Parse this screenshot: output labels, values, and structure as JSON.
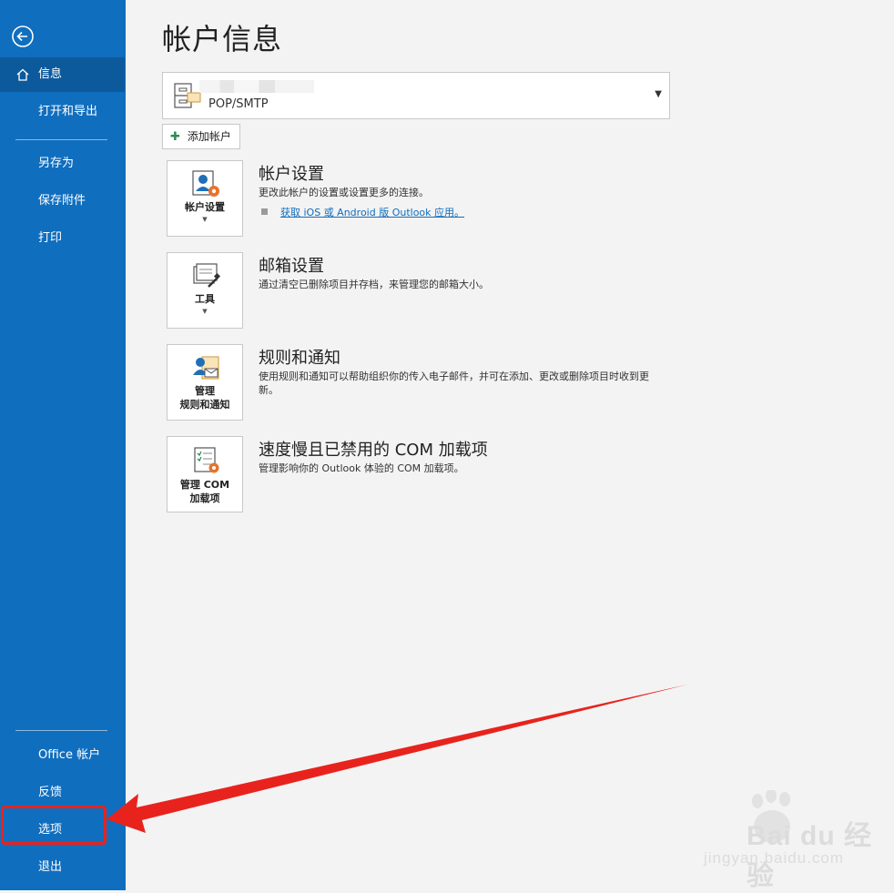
{
  "sidebar": {
    "items": [
      {
        "label": "信息"
      },
      {
        "label": "打开和导出"
      },
      {
        "label": "另存为"
      },
      {
        "label": "保存附件"
      },
      {
        "label": "打印"
      },
      {
        "label": "Office 帐户"
      },
      {
        "label": "反馈"
      },
      {
        "label": "选项"
      },
      {
        "label": "退出"
      }
    ]
  },
  "main": {
    "title": "帐户信息",
    "account": {
      "type": "POP/SMTP"
    },
    "add_account_label": "添加帐户",
    "sections": [
      {
        "button_label": "帐户设置",
        "title": "帐户设置",
        "description": "更改此帐户的设置或设置更多的连接。",
        "link": "获取 iOS 或 Android 版 Outlook 应用。"
      },
      {
        "button_label": "工具",
        "title": "邮箱设置",
        "description": "通过清空已删除项目并存档，来管理您的邮箱大小。"
      },
      {
        "button_label_line1": "管理",
        "button_label_line2": "规则和通知",
        "title": "规则和通知",
        "description": "使用规则和通知可以帮助组织你的传入电子邮件，并可在添加、更改或删除项目时收到更新。"
      },
      {
        "button_label_line1": "管理 COM",
        "button_label_line2": "加载项",
        "title": "速度慢且已禁用的 COM 加载项",
        "description": "管理影响你的 Outlook 体验的 COM 加载项。"
      }
    ]
  },
  "watermark": {
    "text": "Bai du 经验",
    "sub": "jingyan.baidu.com"
  },
  "colors": {
    "sidebar": "#106ebe",
    "selected": "#0c5a9c",
    "annotation": "#e8231d",
    "link": "#0f6cbd"
  },
  "icons": [
    "back-arrow-icon",
    "home-icon",
    "account-icon",
    "tools-icon",
    "rules-icon",
    "com-addin-icon",
    "add-icon",
    "dropdown-caret-icon"
  ]
}
